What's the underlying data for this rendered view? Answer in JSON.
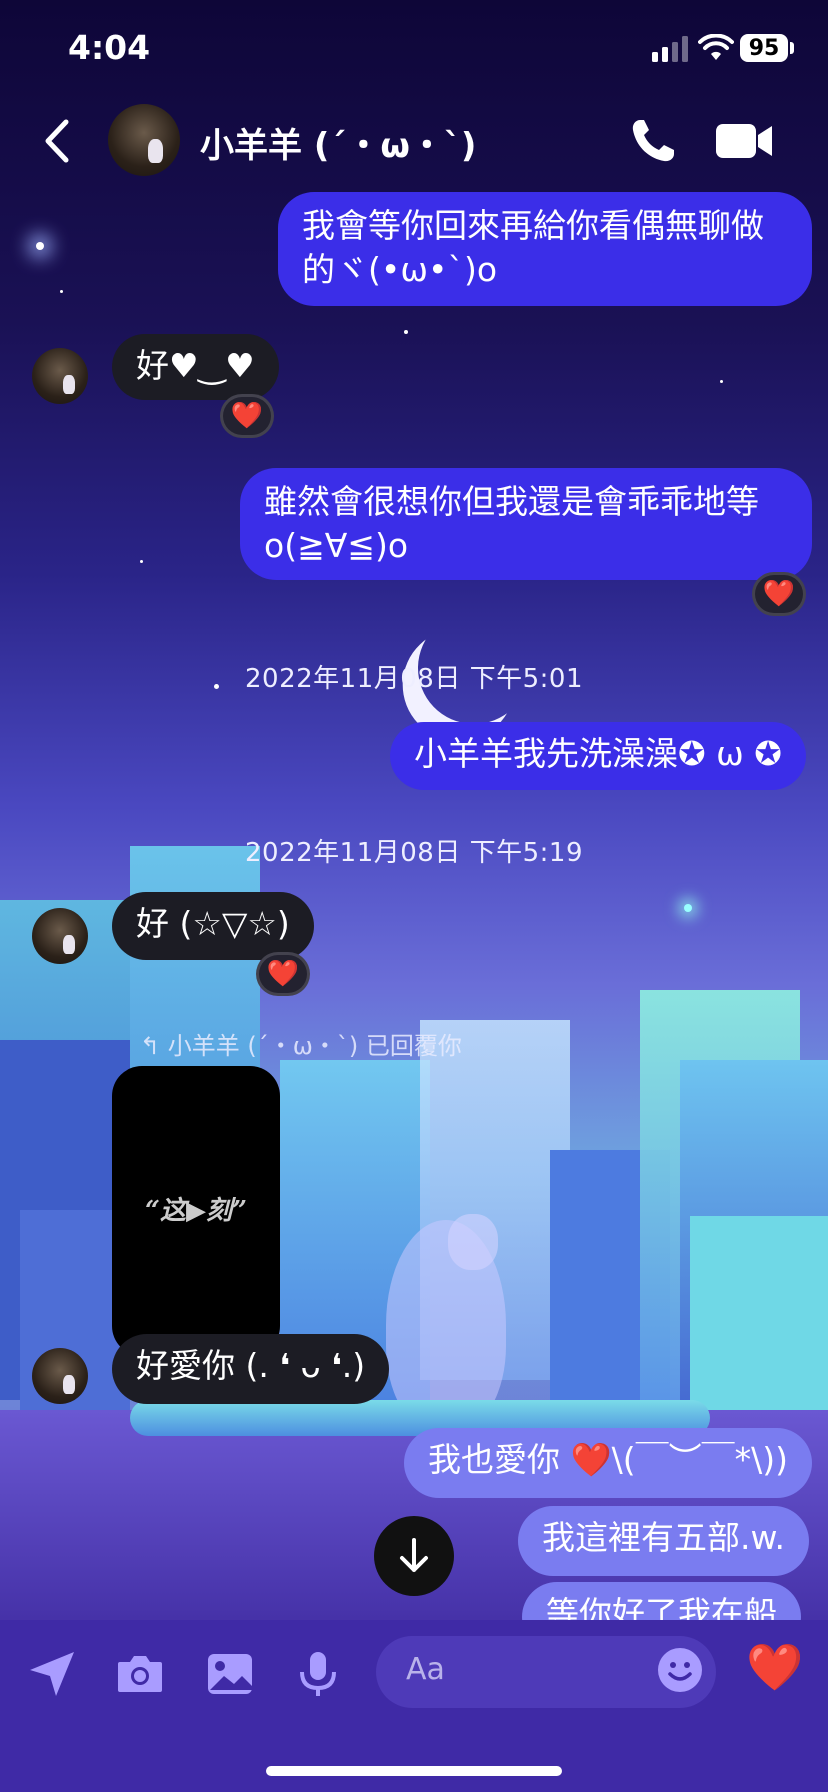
{
  "status_bar": {
    "time": "4:04",
    "battery": "95"
  },
  "header": {
    "contact_name": "小羊羊 (´・ω・`)"
  },
  "messages": [
    {
      "text_line1": "我會等你回來再給你看偶無聊做",
      "text_line2": "的ヾ(•ω•`)o"
    },
    {
      "text": "好♥‿♥",
      "reaction": "❤️"
    },
    {
      "text_line1": "雖然會很想你但我還是會乖乖地等",
      "text_line2": "o(≧∀≦)o",
      "reaction": "❤️"
    },
    {
      "text": "小羊羊我先洗澡澡✪ ω ✪"
    },
    {
      "text": "好 (☆▽☆)",
      "reaction": "❤️"
    },
    {
      "text": "好愛你 (. ❛ ᴗ ❛.)"
    },
    {
      "text": "我也愛你 ❤️\\(￣︶￣*\\))"
    },
    {
      "text": "我這裡有五部.w."
    },
    {
      "text": "等你好了我在船"
    }
  ],
  "timestamps": [
    "2022年11月08日 下午5:01",
    "2022年11月08日 下午5:19"
  ],
  "reply_note": "小羊羊 (´・ω・`) 已回覆你",
  "video_caption": "“这▶刻”",
  "composer": {
    "placeholder": "Aa",
    "like": "❤️"
  },
  "colors": {
    "outgoing": "#3b2ee8",
    "outgoing_light": "#7a7cf0",
    "incoming": "#1c1c24",
    "composer": "#3f2aa6"
  }
}
